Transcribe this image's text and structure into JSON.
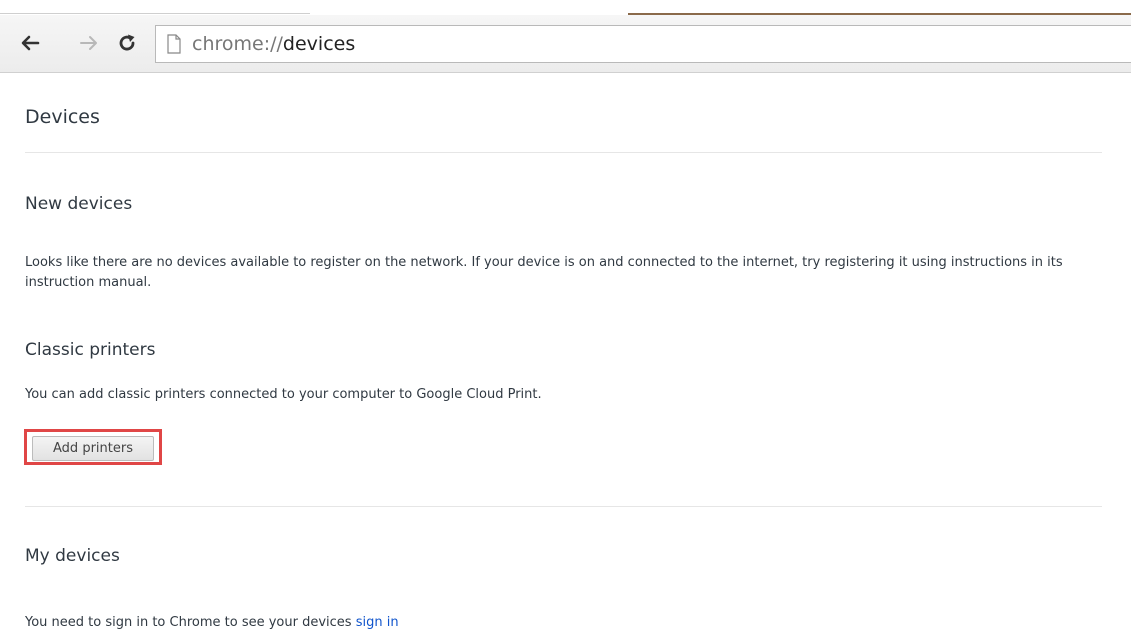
{
  "browser": {
    "url_scheme": "chrome://",
    "url_host": "devices",
    "icons": [
      "back-arrow-icon",
      "forward-arrow-icon",
      "reload-icon",
      "page-icon"
    ]
  },
  "page": {
    "title": "Devices",
    "sections": {
      "new_devices": {
        "heading": "New devices",
        "text": "Looks like there are no devices available to register on the network. If your device is on and connected to the internet, try registering it using instructions in its instruction manual."
      },
      "classic_printers": {
        "heading": "Classic printers",
        "text": "You can add classic printers connected to your computer to Google Cloud Print.",
        "button_label": "Add printers"
      },
      "my_devices": {
        "heading": "My devices",
        "text": "You need to sign in to Chrome to see your devices",
        "link_label": "sign in"
      }
    }
  },
  "colors": {
    "highlight_border": "#e04646",
    "link": "#1155cc"
  }
}
